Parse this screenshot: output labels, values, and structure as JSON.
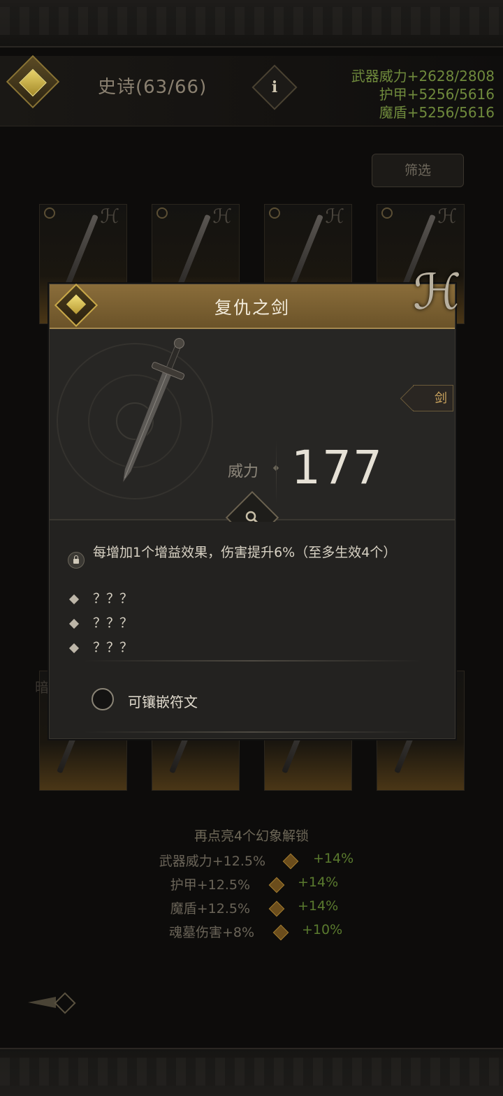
{
  "header": {
    "rarity_title": "史诗(63/66)",
    "info_icon": "i",
    "bonus_lines": [
      "武器威力+2628/2808",
      "护甲+5256/5616",
      "魔盾+5256/5616"
    ]
  },
  "filter": {
    "label": "筛选"
  },
  "modal": {
    "title": "复仇之剑",
    "type_tag": "剑",
    "power_label": "威力",
    "power_value": "177",
    "effects": [
      {
        "text": "每增加1个增益效果，伤害提升6%（至多生效4个）",
        "locked": true
      },
      {
        "text": "？？？",
        "locked": false
      },
      {
        "text": "？？？",
        "locked": false
      },
      {
        "text": "？？？",
        "locked": false
      }
    ],
    "rune_option": "可镶嵌符文"
  },
  "background": {
    "partial_label": "暗"
  },
  "unlock": {
    "title": "再点亮4个幻象解锁",
    "rows": [
      {
        "current": "武器威力+12.5%",
        "next": "+14%"
      },
      {
        "current": "护甲+12.5%",
        "next": "+14%"
      },
      {
        "current": "魔盾+12.5%",
        "next": "+14%"
      },
      {
        "current": "魂墓伤害+8%",
        "next": "+10%"
      }
    ]
  },
  "colors": {
    "accent_gold": "#8a6d3a",
    "bonus_green": "#6f8a3c",
    "next_green": "#5a7a2e"
  },
  "icons": [
    "rarity-diamond-icon",
    "info-icon",
    "sword-icon",
    "search-icon",
    "lock-icon",
    "back-arrow-icon"
  ]
}
